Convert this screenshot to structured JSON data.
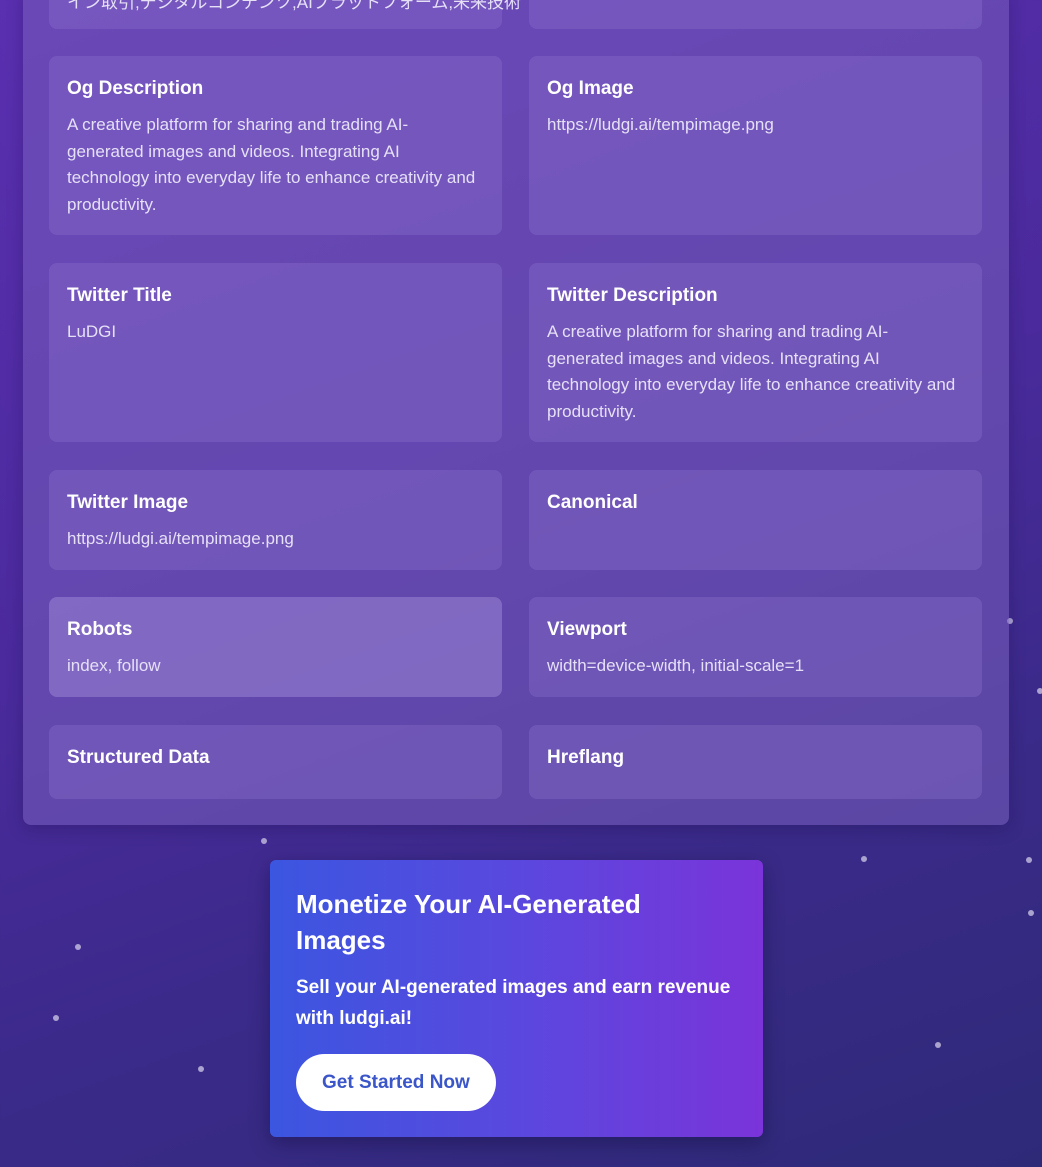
{
  "partial_top_text": "イン取引,デジタルコンテンツ,AIプラットフォーム,未来技術",
  "meta_fields": [
    {
      "label": "Og Description",
      "value": "A creative platform for sharing and trading AI-generated images and videos. Integrating AI technology into everyday life to enhance creativity and productivity."
    },
    {
      "label": "Og Image",
      "value": "https://ludgi.ai/tempimage.png"
    },
    {
      "label": "Twitter Title",
      "value": "LuDGI"
    },
    {
      "label": "Twitter Description",
      "value": "A creative platform for sharing and trading AI-generated images and videos. Integrating AI technology into everyday life to enhance creativity and productivity."
    },
    {
      "label": "Twitter Image",
      "value": "https://ludgi.ai/tempimage.png"
    },
    {
      "label": "Canonical",
      "value": ""
    },
    {
      "label": "Robots",
      "value": "index, follow"
    },
    {
      "label": "Viewport",
      "value": "width=device-width, initial-scale=1"
    },
    {
      "label": "Structured Data",
      "value": ""
    },
    {
      "label": "Hreflang",
      "value": ""
    }
  ],
  "cta": {
    "title": "Monetize Your AI-Generated Images",
    "subtitle": "Sell your AI-generated images and earn revenue with ludgi.ai!",
    "button_label": "Get Started Now"
  }
}
